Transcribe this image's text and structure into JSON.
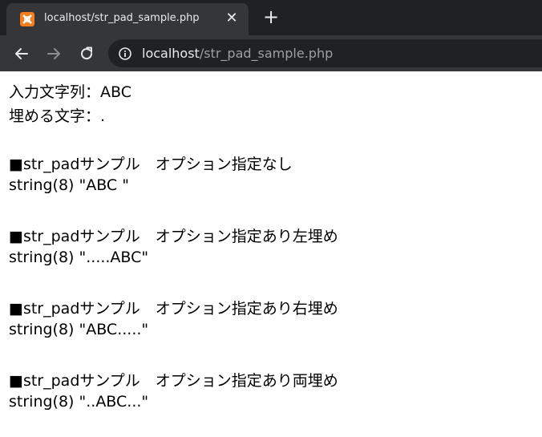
{
  "browser": {
    "tab": {
      "title": "localhost/str_pad_sample.php",
      "close": "✕"
    },
    "new_tab": "+",
    "address": {
      "host": "localhost",
      "path": "/str_pad_sample.php"
    }
  },
  "page": {
    "lines": [
      "入力文字列：ABC",
      "埋める文字：.",
      "",
      "■str_padサンプル　オプション指定なし",
      "string(8) \"ABC \"",
      "",
      "■str_padサンプル　オプション指定あり左埋め",
      "string(8) \".....ABC\"",
      "",
      "■str_padサンプル　オプション指定あり右埋め",
      "string(8) \"ABC.....\"",
      "",
      "■str_padサンプル　オプション指定あり両埋め",
      "string(8) \"..ABC...\""
    ]
  }
}
